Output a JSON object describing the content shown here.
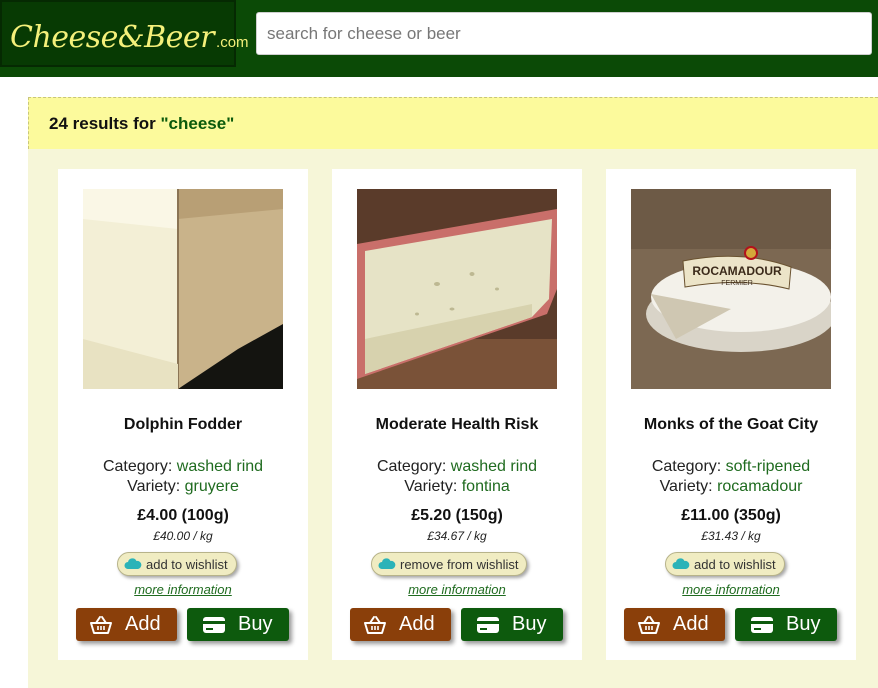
{
  "header": {
    "logo_main": "Cheese&Beer",
    "logo_suffix": ".com",
    "search_placeholder": "search for cheese or beer"
  },
  "results": {
    "prefix": "24 results for ",
    "query": "\"cheese\""
  },
  "labels": {
    "category": "Category: ",
    "variety": "Variety: ",
    "more_info": "more information",
    "add": "Add",
    "buy": "Buy"
  },
  "products": [
    {
      "name": "Dolphin Fodder",
      "category": "washed rind",
      "variety": "gruyere",
      "price": "£4.00 (100g)",
      "per_kg": "£40.00 / kg",
      "wishlist_label": "add to wishlist"
    },
    {
      "name": "Moderate Health Risk",
      "category": "washed rind",
      "variety": "fontina",
      "price": "£5.20 (150g)",
      "per_kg": "£34.67 / kg",
      "wishlist_label": "remove from wishlist"
    },
    {
      "name": "Monks of the Goat City",
      "category": "soft-ripened",
      "variety": "rocamadour",
      "price": "£11.00 (350g)",
      "per_kg": "£31.43 / kg",
      "wishlist_label": "add to wishlist",
      "image_label_line1": "ROCAMADOUR",
      "image_label_line2": "FERMIER"
    }
  ],
  "colors": {
    "header_bg": "#0b4a06",
    "logo_text": "#f4f07a",
    "results_bar_bg": "#fcfa9c",
    "content_bg": "#f6f6d8",
    "link_green": "#1f6b1f",
    "add_button": "#8a3f0a",
    "buy_button": "#0d5a0d",
    "wishlist_cloud": "#2bb3b8"
  }
}
